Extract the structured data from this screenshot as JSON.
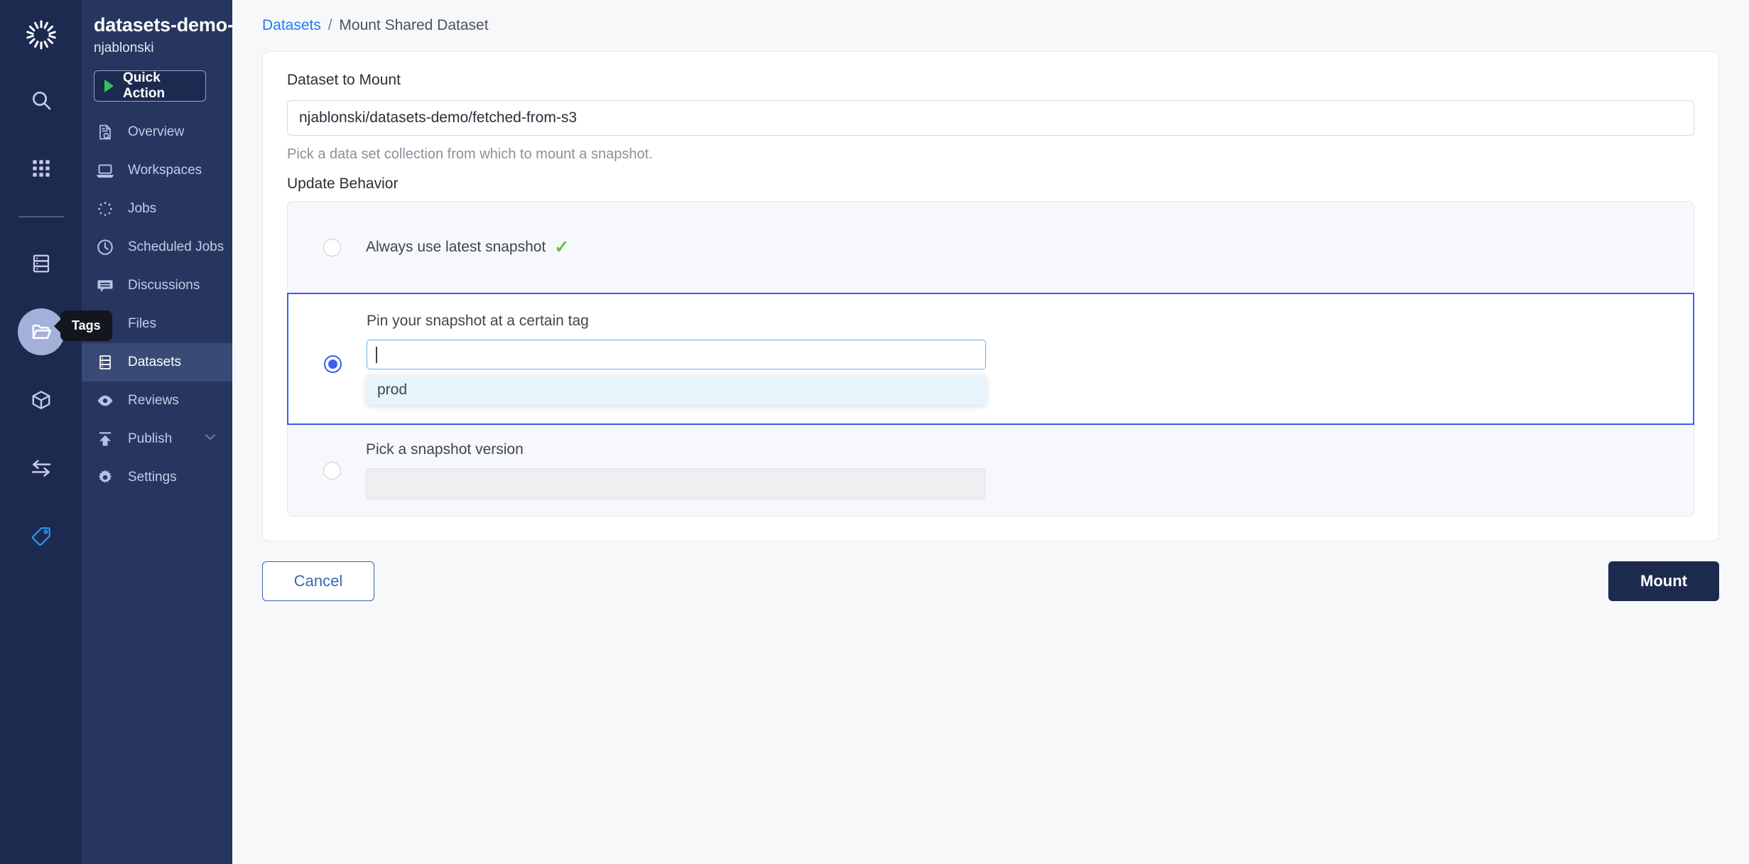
{
  "rail": {
    "logo_icon": "aperture-logo-icon",
    "items": [
      {
        "name": "search-icon",
        "active": false
      },
      {
        "name": "grid-apps-icon",
        "active": false
      },
      {
        "name": "server-datasets-icon",
        "active": false
      },
      {
        "name": "folder-open-icon",
        "active": true
      },
      {
        "name": "cube-model-icon",
        "active": false
      },
      {
        "name": "transfer-arrows-icon",
        "active": false
      },
      {
        "name": "tag-icon",
        "active": false
      }
    ]
  },
  "sidebar": {
    "project_title": "datasets-demo-co...",
    "owner": "njablonski",
    "quick_action_label": "Quick Action",
    "tooltip_label": "Tags",
    "items": [
      {
        "label": "Overview",
        "icon": "document-search-icon",
        "active": false,
        "chevron": ""
      },
      {
        "label": "Workspaces",
        "icon": "laptop-icon",
        "active": false,
        "chevron": ""
      },
      {
        "label": "Jobs",
        "icon": "spinner-dots-icon",
        "active": false,
        "chevron": ""
      },
      {
        "label": "Scheduled Jobs",
        "icon": "clock-icon",
        "active": false,
        "chevron": ""
      },
      {
        "label": "Discussions",
        "icon": "chat-bubble-icon",
        "active": false,
        "chevron": ""
      },
      {
        "label": "Files",
        "icon": "file-icon",
        "active": false,
        "chevron": ""
      },
      {
        "label": "Datasets",
        "icon": "server-icon",
        "active": true,
        "chevron": ""
      },
      {
        "label": "Reviews",
        "icon": "eye-icon",
        "active": false,
        "chevron": ""
      },
      {
        "label": "Publish",
        "icon": "upload-icon",
        "active": false,
        "chevron": "⌄"
      },
      {
        "label": "Settings",
        "icon": "gear-icon",
        "active": false,
        "chevron": ""
      }
    ]
  },
  "breadcrumb": {
    "link": "Datasets",
    "separator": "/",
    "current": "Mount Shared Dataset"
  },
  "form": {
    "dataset_label": "Dataset to Mount",
    "dataset_value": "njablonski/datasets-demo/fetched-from-s3",
    "dataset_helper": "Pick a data set collection from which to mount a snapshot.",
    "update_behavior_label": "Update Behavior",
    "options": [
      {
        "id": "always-latest",
        "label": "Always use latest snapshot",
        "check_mark": "✓",
        "selected": false
      },
      {
        "id": "pin-tag",
        "label": "Pin your snapshot at a certain tag",
        "input_value": "",
        "selected": true,
        "dropdown_options": [
          "prod"
        ]
      },
      {
        "id": "pick-version",
        "label": "Pick a snapshot version",
        "input_value": "",
        "selected": false
      }
    ]
  },
  "footer": {
    "cancel_label": "Cancel",
    "mount_label": "Mount"
  },
  "colors": {
    "rail_bg": "#1d2a50",
    "sidebar_bg": "#27365e",
    "accent_blue": "#3b5ef5",
    "link_blue": "#1f7bf7",
    "check_green": "#63c33b",
    "play_green": "#2fc45a",
    "dropdown_highlight": "#e6f4fc"
  }
}
